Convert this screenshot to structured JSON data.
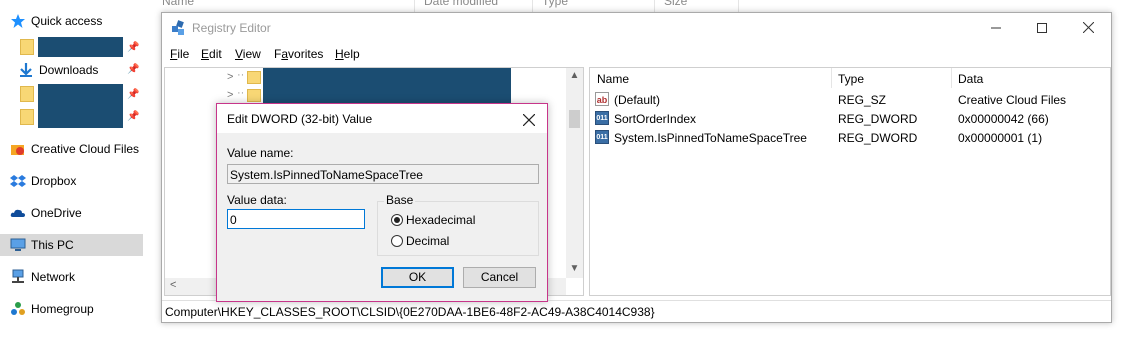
{
  "explorer": {
    "header": {
      "col_name": "Name",
      "col_date": "Date modified",
      "col_type": "Type",
      "col_size": "Size"
    },
    "nav": {
      "quick_access": "Quick access",
      "downloads": "Downloads",
      "creative_cloud": "Creative Cloud Files",
      "dropbox": "Dropbox",
      "onedrive": "OneDrive",
      "this_pc": "This PC",
      "network": "Network",
      "homegroup": "Homegroup"
    }
  },
  "regedit": {
    "title": "Registry Editor",
    "menu": {
      "file": {
        "accel": "F",
        "rest": "ile"
      },
      "edit": {
        "accel": "E",
        "rest": "dit"
      },
      "view": {
        "accel": "V",
        "rest": "iew"
      },
      "favorites": {
        "pre": "F",
        "accel": "a",
        "rest": "vorites"
      },
      "help": {
        "accel": "H",
        "rest": "elp"
      }
    },
    "list": {
      "headers": {
        "name": "Name",
        "type": "Type",
        "data": "Data"
      },
      "rows": [
        {
          "icon": "string-value-icon",
          "name": "(Default)",
          "type": "REG_SZ",
          "data": "Creative Cloud Files"
        },
        {
          "icon": "dword-value-icon",
          "name": "SortOrderIndex",
          "type": "REG_DWORD",
          "data": "0x00000042 (66)"
        },
        {
          "icon": "dword-value-icon",
          "name": "System.IsPinnedToNameSpaceTree",
          "type": "REG_DWORD",
          "data": "0x00000001 (1)"
        }
      ]
    },
    "status_path": "Computer\\HKEY_CLASSES_ROOT\\CLSID\\{0E270DAA-1BE6-48F2-AC49-A38C4014C938}"
  },
  "dialog": {
    "title": "Edit DWORD (32-bit) Value",
    "value_name_label": "Value name:",
    "value_name": "System.IsPinnedToNameSpaceTree",
    "value_data_label": "Value data:",
    "value_data": "0",
    "base_label": "Base",
    "hex_label": "Hexadecimal",
    "dec_label": "Decimal",
    "base_selected": "Hexadecimal",
    "ok_label": "OK",
    "cancel_label": "Cancel"
  },
  "colors": {
    "accent": "#0078d7",
    "dialog_border": "#c7358a",
    "redaction": "#1b4d72"
  }
}
